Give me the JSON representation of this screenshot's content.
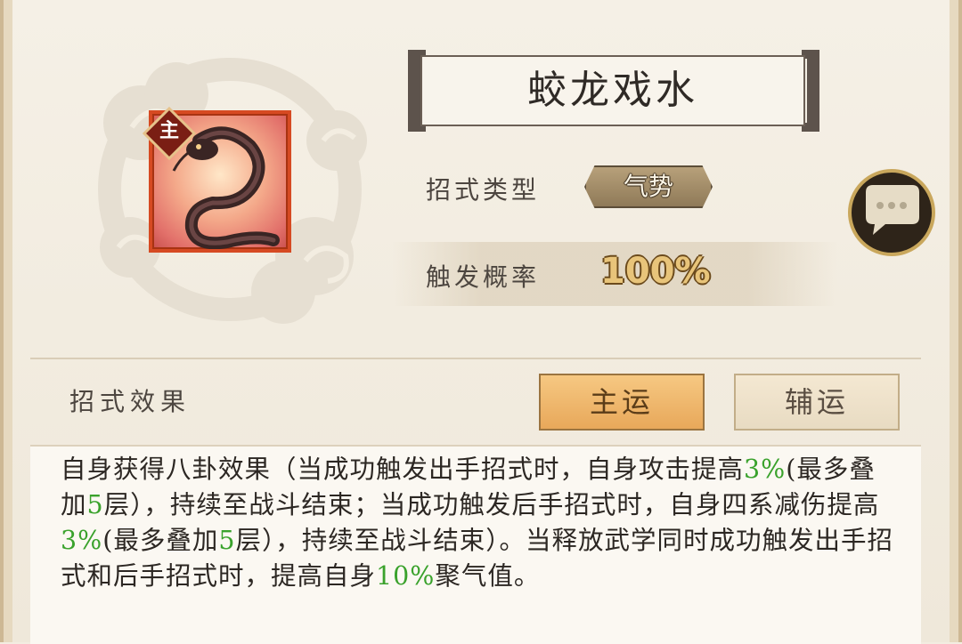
{
  "skill": {
    "name": "蛟龙戏水",
    "role_badge": "主",
    "type_label": "招式类型",
    "type_value": "气势",
    "rate_label": "触发概率",
    "rate_value": "100%"
  },
  "effect": {
    "label": "招式效果",
    "tabs": [
      "主运",
      "辅运"
    ],
    "active_tab": "主运",
    "description": [
      {
        "text": "自身获得八卦效果（当成功触发出手招式时，自身攻击提高",
        "hl": false
      },
      {
        "text": "3%",
        "hl": true
      },
      {
        "text": "(最多叠加",
        "hl": false
      },
      {
        "text": "5",
        "hl": true
      },
      {
        "text": "层），持续至战斗结束；当成功触发后手招式时，自身四系减伤提高",
        "hl": false
      },
      {
        "text": "3%",
        "hl": true
      },
      {
        "text": "(最多叠加",
        "hl": false
      },
      {
        "text": "5",
        "hl": true
      },
      {
        "text": "层），持续至战斗结束）。当释放武学同时成功触发出手招式和后手招式时，提高自身",
        "hl": false
      },
      {
        "text": "10%",
        "hl": true
      },
      {
        "text": "聚气值。",
        "hl": false
      }
    ]
  },
  "colors": {
    "highlight": "#3aa22c",
    "tab_active": "#e8a85a",
    "icon_border": "#d64a22"
  },
  "icons": [
    "cloud-emblem",
    "dragon-skill-icon",
    "chat-bubble-icon"
  ]
}
